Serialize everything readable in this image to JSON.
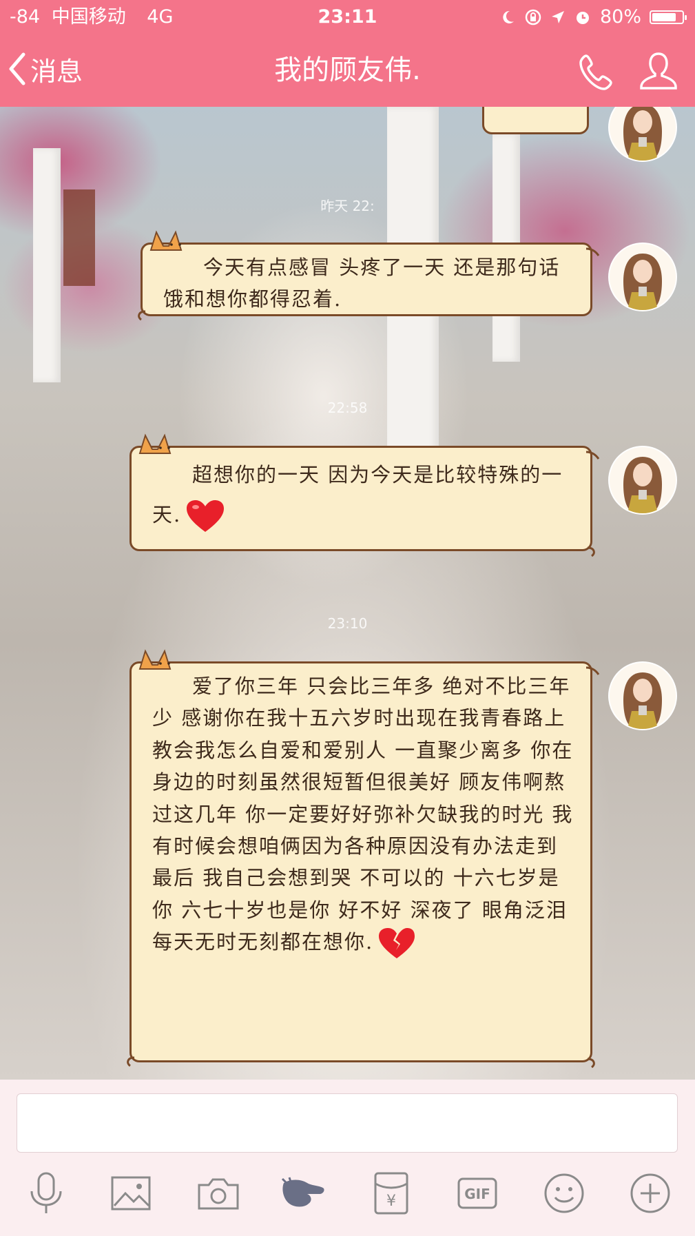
{
  "status_bar": {
    "signal": "-84",
    "carrier": "中国移动",
    "network": "4G",
    "time": "23:11",
    "battery_percent": "80%",
    "battery_level": 0.8
  },
  "nav": {
    "back_label": "消息",
    "title": "我的顾友伟."
  },
  "timestamps": [
    "昨天 22:",
    "22:58",
    "23:10"
  ],
  "messages": [
    {
      "text": "今天有点感冒 头疼了一天 还是那句话饿和想你都得忍着."
    },
    {
      "text": "超想你的一天 因为今天是比较特殊的一天.",
      "emoji": "red-heart"
    },
    {
      "text": "爱了你三年 只会比三年多 绝对不比三年少 感谢你在我十五六岁时出现在我青春路上 教会我怎么自爱和爱别人 一直聚少离多 你在身边的时刻虽然很短暂但很美好 顾友伟啊熬过这几年 你一定要好好弥补欠缺我的时光 我有时候会想咱俩因为各种原因没有办法走到最后 我自己会想到哭 不可以的 十六七岁是你 六七十岁也是你 好不好 深夜了 眼角泛泪 每天无时无刻都在想你.",
      "emoji": "broken-heart"
    }
  ],
  "toolbar": {
    "icons": [
      "microphone-icon",
      "image-icon",
      "camera-icon",
      "poke-icon",
      "red-packet-icon",
      "gif-icon",
      "emoji-icon",
      "plus-icon"
    ],
    "gif_label": "GIF",
    "redpacket_label": "¥"
  },
  "colors": {
    "header": "#f4748a",
    "bubble": "#fbeecb",
    "bubble_border": "#7a4a28"
  }
}
